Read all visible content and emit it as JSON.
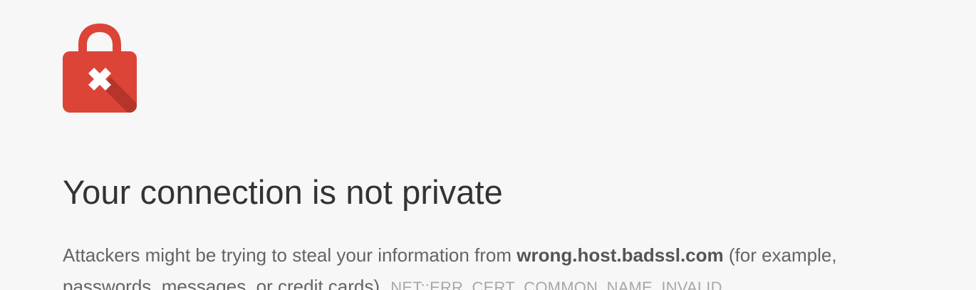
{
  "page": {
    "icon": "lock-error-icon",
    "title": "Your connection is not private",
    "message": {
      "before_host": "Attackers might be trying to steal your information from ",
      "host": "wrong.host.badssl.com",
      "after_host": " (for example, passwords, messages, or credit cards).",
      "error_code": "NET::ERR_CERT_COMMON_NAME_INVALID"
    }
  },
  "colors": {
    "background": "#f7f7f7",
    "lock_red": "#db4437",
    "title_text": "#333333",
    "body_text": "#646464",
    "error_code_text": "#a8a8a8"
  }
}
